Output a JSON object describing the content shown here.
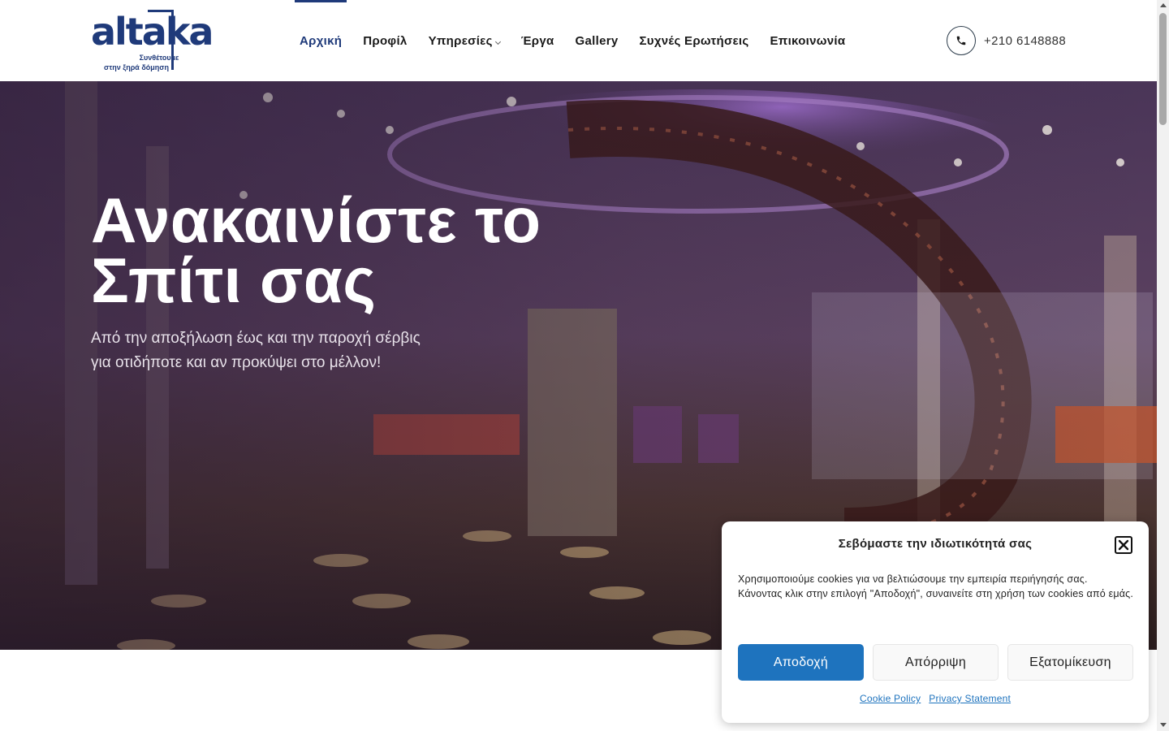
{
  "brand": {
    "logo_word": "altaka",
    "tagline_line1": "Συνθέτουμε",
    "tagline_line2": "στην ξηρά δόμηση",
    "color": "#1f3a7a"
  },
  "nav": {
    "items": [
      {
        "label": "Αρχική",
        "active": true
      },
      {
        "label": "Προφίλ"
      },
      {
        "label": "Υπηρεσίες",
        "has_dropdown": true
      },
      {
        "label": "Έργα"
      },
      {
        "label": "Gallery"
      },
      {
        "label": "Συχνές Ερωτήσεις"
      },
      {
        "label": "Επικοινωνία"
      }
    ]
  },
  "contact": {
    "phone": "+210 6148888",
    "icon": "phone-icon"
  },
  "hero": {
    "title_line1": "Ανακαινίστε το",
    "title_line2": "Σπίτι σας",
    "subtitle": "Από την αποξήλωση έως και την παροχή σέρβις για οτιδήποτε και αν προκύψει στο μέλλον!"
  },
  "cookie": {
    "title": "Σεβόμαστε την ιδιωτικότητά σας",
    "text": "Χρησιμοποιούμε cookies για να βελτιώσουμε την εμπειρία περιήγησής σας. Κάνοντας κλικ στην επιλογή \"Αποδοχή\", συναινείτε στη χρήση των cookies από εμάς.",
    "accept_label": "Αποδοχή",
    "reject_label": "Απόρριψη",
    "customize_label": "Εξατομίκευση",
    "cookie_policy_link": "Cookie Policy",
    "privacy_link": "Privacy Statement",
    "accent": "#1e73be"
  }
}
